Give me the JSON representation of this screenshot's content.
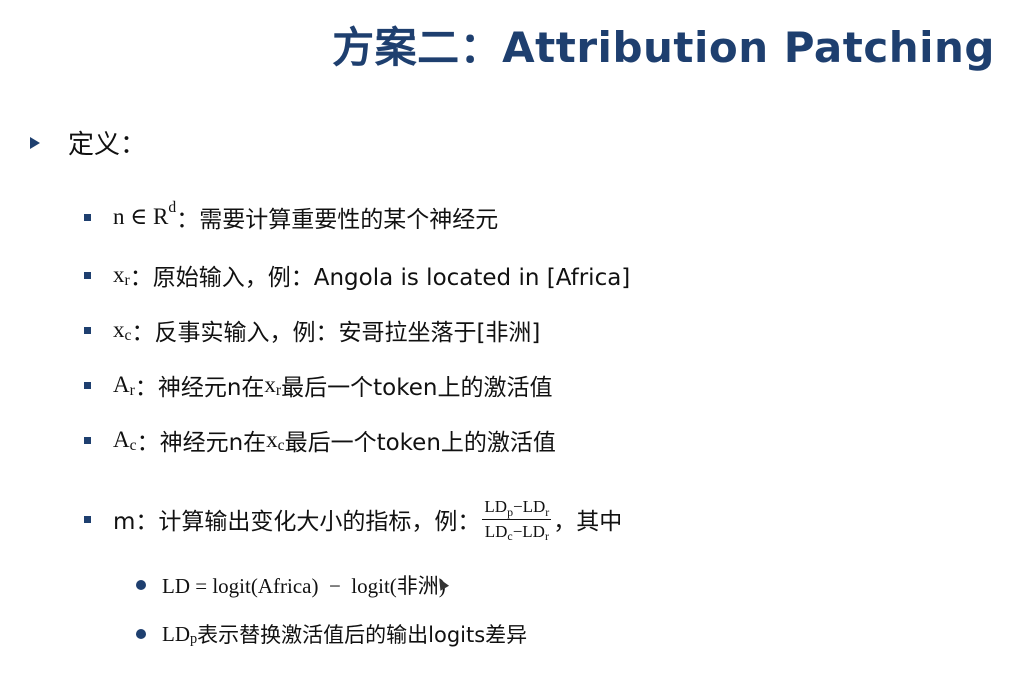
{
  "title": "方案二：Attribution Patching",
  "definition_label": "定义：",
  "items": [
    {
      "symbol": "n ∈ R",
      "sup": "d",
      "text": " ：需要计算重要性的某个神经元"
    },
    {
      "symbol": "x",
      "sub": "r",
      "text": "：原始输入，例：Angola is located in [Africa]"
    },
    {
      "symbol": "x",
      "sub": "c",
      "text": "：反事实输入，例：安哥拉坐落于[非洲]"
    },
    {
      "symbol": "A",
      "sub": "r",
      "text_a": "：神经元n在",
      "inner_symbol": "x",
      "inner_sub": "r",
      "text_b": "最后一个token上的激活值"
    },
    {
      "symbol": "A",
      "sub": "c",
      "text_a": "：神经元n在",
      "inner_symbol": "x",
      "inner_sub": "c",
      "text_b": "最后一个token上的激活值"
    },
    {
      "text_a": "m：计算输出变化大小的指标，例：",
      "fraction": {
        "num_a": "LD",
        "num_a_sub": "p",
        "num_op": "−",
        "num_b": "LD",
        "num_b_sub": "r",
        "den_a": "LD",
        "den_a_sub": "c",
        "den_op": "−",
        "den_b": "LD",
        "den_b_sub": "r"
      },
      "text_b": "，其中"
    }
  ],
  "subitems": [
    {
      "text": "LD = logit(Africa)  −  logit(非洲)"
    },
    {
      "symbol": "LD",
      "sub": "p",
      "text": "表示替换激活值后的输出logits差异"
    }
  ],
  "colors": {
    "title": "#1e3f6f",
    "bullet": "#1e3f6f",
    "text": "#111111"
  }
}
